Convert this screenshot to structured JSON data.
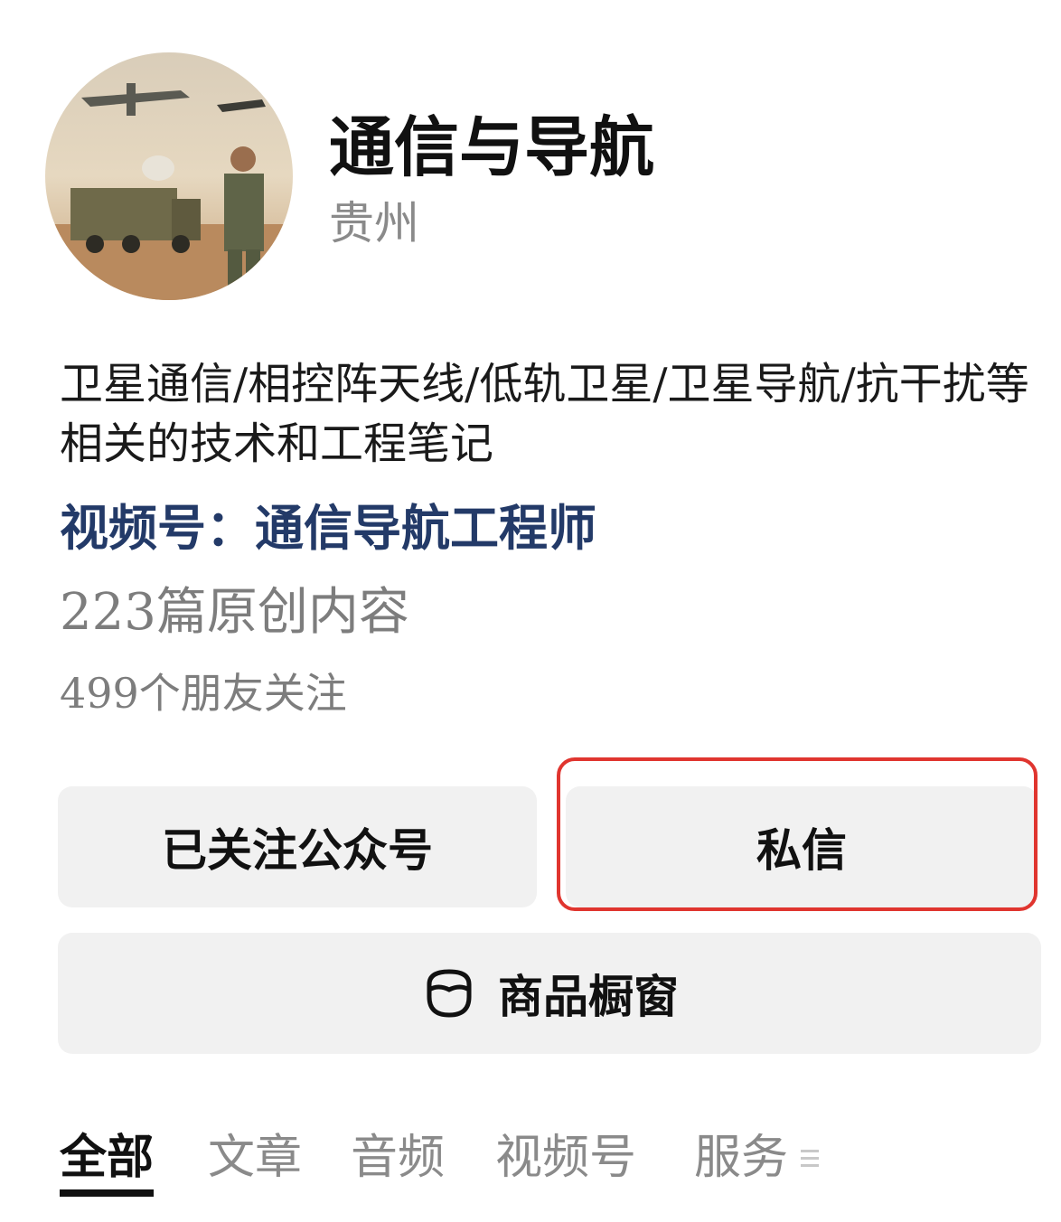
{
  "profile": {
    "name": "通信与导航",
    "location": "贵州",
    "bio": "卫星通信/相控阵天线/低轨卫星/卫星导航/抗干扰等相关的技术和工程笔记",
    "channel": "视频号：通信导航工程师",
    "articles": "223篇原创内容",
    "followers": "499个朋友关注"
  },
  "actions": {
    "follow_label": "已关注公众号",
    "message_label": "私信",
    "shop_label": "商品橱窗"
  },
  "tabs": [
    {
      "label": "全部",
      "active": true
    },
    {
      "label": "文章",
      "active": false
    },
    {
      "label": "音频",
      "active": false
    },
    {
      "label": "视频号",
      "active": false
    },
    {
      "label": "服务",
      "active": false
    }
  ],
  "colors": {
    "channel_text": "#233a68",
    "muted_text": "#8a8a8a",
    "button_bg": "#f1f1f1",
    "highlight_border": "#e0352f"
  }
}
